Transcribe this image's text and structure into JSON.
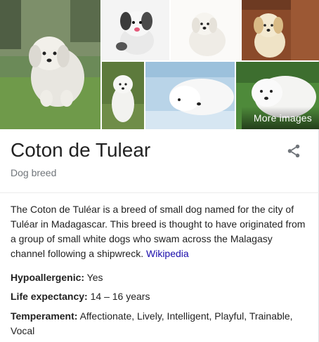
{
  "images": {
    "more_images_label": "More images"
  },
  "header": {
    "title": "Coton de Tulear",
    "subtitle": "Dog breed"
  },
  "description": {
    "text": "The Coton de Tuléar is a breed of small dog named for the city of Tuléar in Madagascar. This breed is thought to have originated from a group of small white dogs who swam across the Malagasy channel following a shipwreck.",
    "source_link": "Wikipedia"
  },
  "facts": [
    {
      "label": "Hypoallergenic:",
      "value": "Yes"
    },
    {
      "label": "Life expectancy:",
      "value": "14 – 16 years"
    },
    {
      "label": "Temperament:",
      "value": "Affectionate, Lively, Intelligent, Playful, Trainable, Vocal"
    }
  ],
  "colors": {
    "link": "#1a0dab",
    "subtitle": "#70757a",
    "divider": "#ebebeb"
  },
  "icons": {
    "share": "share-icon"
  }
}
